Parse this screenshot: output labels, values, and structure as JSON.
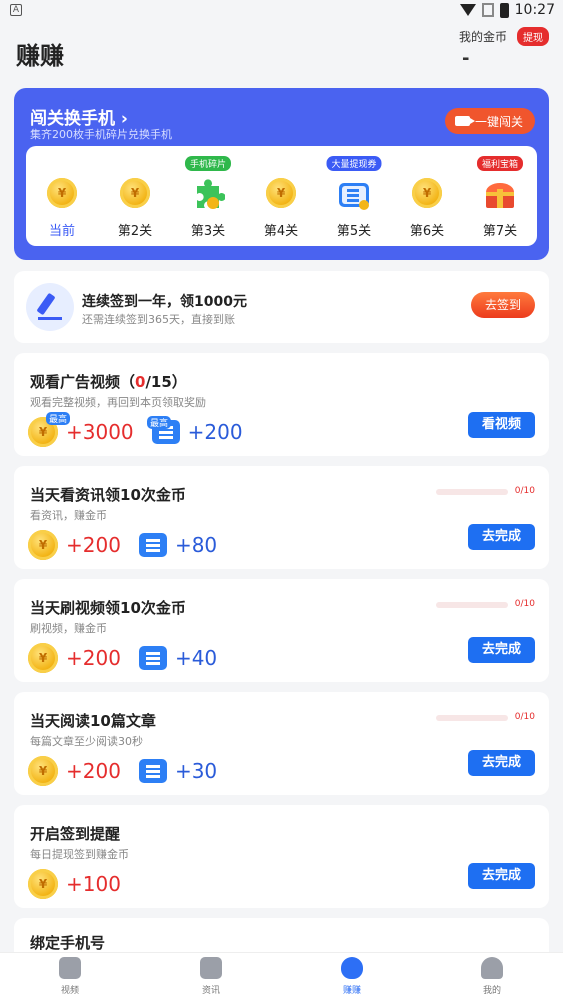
{
  "status": {
    "time": "10:27",
    "left_icon": "A"
  },
  "header": {
    "title": "赚赚",
    "coins_label": "我的金币",
    "withdraw_label": "提现",
    "coins_value": "-"
  },
  "banner": {
    "title": "闯关换手机 ›",
    "subtitle": "集齐200枚手机碎片兑换手机",
    "button": "一键闯关",
    "levels": [
      {
        "label": "当前",
        "icon": "gold-coin",
        "tag": ""
      },
      {
        "label": "第2关",
        "icon": "gold-coin",
        "tag": ""
      },
      {
        "label": "第3关",
        "icon": "phone-fragment",
        "tag": "手机碎片"
      },
      {
        "label": "第4关",
        "icon": "gold-coin",
        "tag": ""
      },
      {
        "label": "第5关",
        "icon": "withdraw-ticket",
        "tag": "大量提现券"
      },
      {
        "label": "第6关",
        "icon": "gold-coin",
        "tag": ""
      },
      {
        "label": "第7关",
        "icon": "treasure-chest",
        "tag": "福利宝箱"
      }
    ]
  },
  "signin": {
    "title": "连续签到一年，领1000元",
    "subtitle": "还需连续签到365天，直接到账",
    "button": "去签到"
  },
  "tasks": [
    {
      "title_prefix": "观看广告视频（",
      "title_count": "0",
      "title_suffix": "/15）",
      "subtitle": "观看完整视频，再回到本页领取奖励",
      "coin_reward": "+3000",
      "ticket_reward": "+200",
      "max_label": "最高",
      "button": "看视频"
    },
    {
      "title": "当天看资讯领10次金币",
      "subtitle": "看资讯，赚金币",
      "progress": "0/10",
      "progress_value": 0,
      "coin_reward": "+200",
      "ticket_reward": "+80",
      "button": "去完成"
    },
    {
      "title": "当天刷视频领10次金币",
      "subtitle": "刷视频，赚金币",
      "progress": "0/10",
      "progress_value": 0,
      "coin_reward": "+200",
      "ticket_reward": "+40",
      "button": "去完成"
    },
    {
      "title": "当天阅读10篇文章",
      "subtitle": "每篇文章至少阅读30秒",
      "progress": "0/10",
      "progress_value": 0,
      "coin_reward": "+200",
      "ticket_reward": "+30",
      "button": "去完成"
    },
    {
      "title": "开启签到提醒",
      "subtitle": "每日提现签到赚金币",
      "coin_reward": "+100",
      "button": "去完成"
    },
    {
      "title": "绑定手机号"
    }
  ],
  "coin_symbol": "¥",
  "tabbar": [
    {
      "label": "视频",
      "icon": "video-icon"
    },
    {
      "label": "资讯",
      "icon": "news-icon"
    },
    {
      "label": "赚赚",
      "icon": "money-bag-icon",
      "active": true
    },
    {
      "label": "我的",
      "icon": "profile-icon"
    }
  ],
  "colors": {
    "accent": "#4a63f0",
    "red": "#e52d2d",
    "button_blue": "#1e6ff2"
  }
}
